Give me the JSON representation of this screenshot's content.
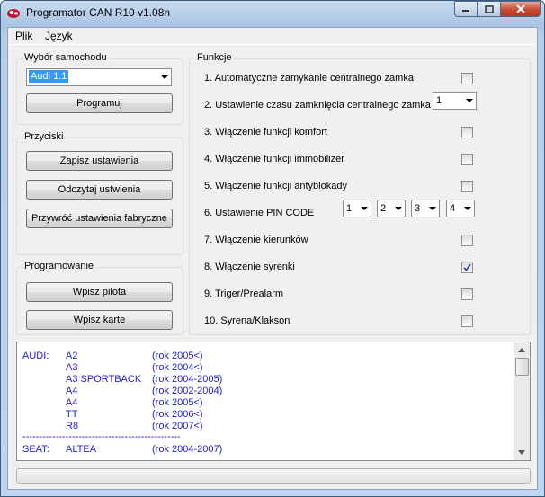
{
  "window": {
    "title": "Programator CAN R10 v1.08n",
    "buttons": {
      "minimize_icon": "minimize-icon",
      "maximize_icon": "maximize-icon",
      "close_icon": "close-icon"
    }
  },
  "menu": [
    "Plik",
    "Język"
  ],
  "car_group": {
    "label": "Wybór samochodu",
    "selected": "Audi 1.1",
    "program_button": "Programuj"
  },
  "buttons_group": {
    "label": "Przyciski",
    "save": "Zapisz ustawienia",
    "read": "Odczytaj ustwienia",
    "restore": "Przywróć ustawienia fabryczne"
  },
  "programming_group": {
    "label": "Programowanie",
    "remote": "Wpisz pilota",
    "card": "Wpisz karte"
  },
  "functions": {
    "label": "Funkcje",
    "items": [
      {
        "label": "1. Automatyczne zamykanie centralnego zamka",
        "checked": false
      },
      {
        "label": "2. Ustawienie czasu zamknięcia centralnego zamka",
        "select": "1"
      },
      {
        "label": "3. Włączenie funkcji komfort",
        "checked": false
      },
      {
        "label": "4. Włączenie funkcji immobilizer",
        "checked": false
      },
      {
        "label": "5. Włączenie funkcji antyblokady",
        "checked": false
      },
      {
        "label": "6. Ustawienie PIN CODE",
        "pin": [
          "1",
          "2",
          "3",
          "4"
        ]
      },
      {
        "label": "7. Włączenie kierunków",
        "checked": false
      },
      {
        "label": "8. Włączenie syrenki",
        "checked": true
      },
      {
        "label": "9. Triger/Prealarm",
        "checked": false
      },
      {
        "label": "10. Syrena/Klakson",
        "checked": false
      }
    ]
  },
  "car_list": {
    "rows": [
      {
        "brand": "AUDI:",
        "model": "A2",
        "years": "(rok 2005<)"
      },
      {
        "brand": "",
        "model": "A3",
        "years": "(rok 2004<)"
      },
      {
        "brand": "",
        "model": "A3 SPORTBACK",
        "years": "(rok 2004-2005)"
      },
      {
        "brand": "",
        "model": "A4",
        "years": "(rok 2002-2004)"
      },
      {
        "brand": "",
        "model": "A4",
        "years": "(rok 2005<)"
      },
      {
        "brand": "",
        "model": "TT",
        "years": "(rok 2006<)"
      },
      {
        "brand": "",
        "model": "R8",
        "years": "(rok 2007<)"
      }
    ],
    "separator": "------------------------------------------------",
    "rows2": [
      {
        "brand": "SEAT:",
        "model": "ALTEA",
        "years": "(rok 2004-2007)"
      }
    ]
  },
  "colors": {
    "list_text": "#2222cc",
    "selection": "#3399ff",
    "close_button": "#c94a32"
  }
}
